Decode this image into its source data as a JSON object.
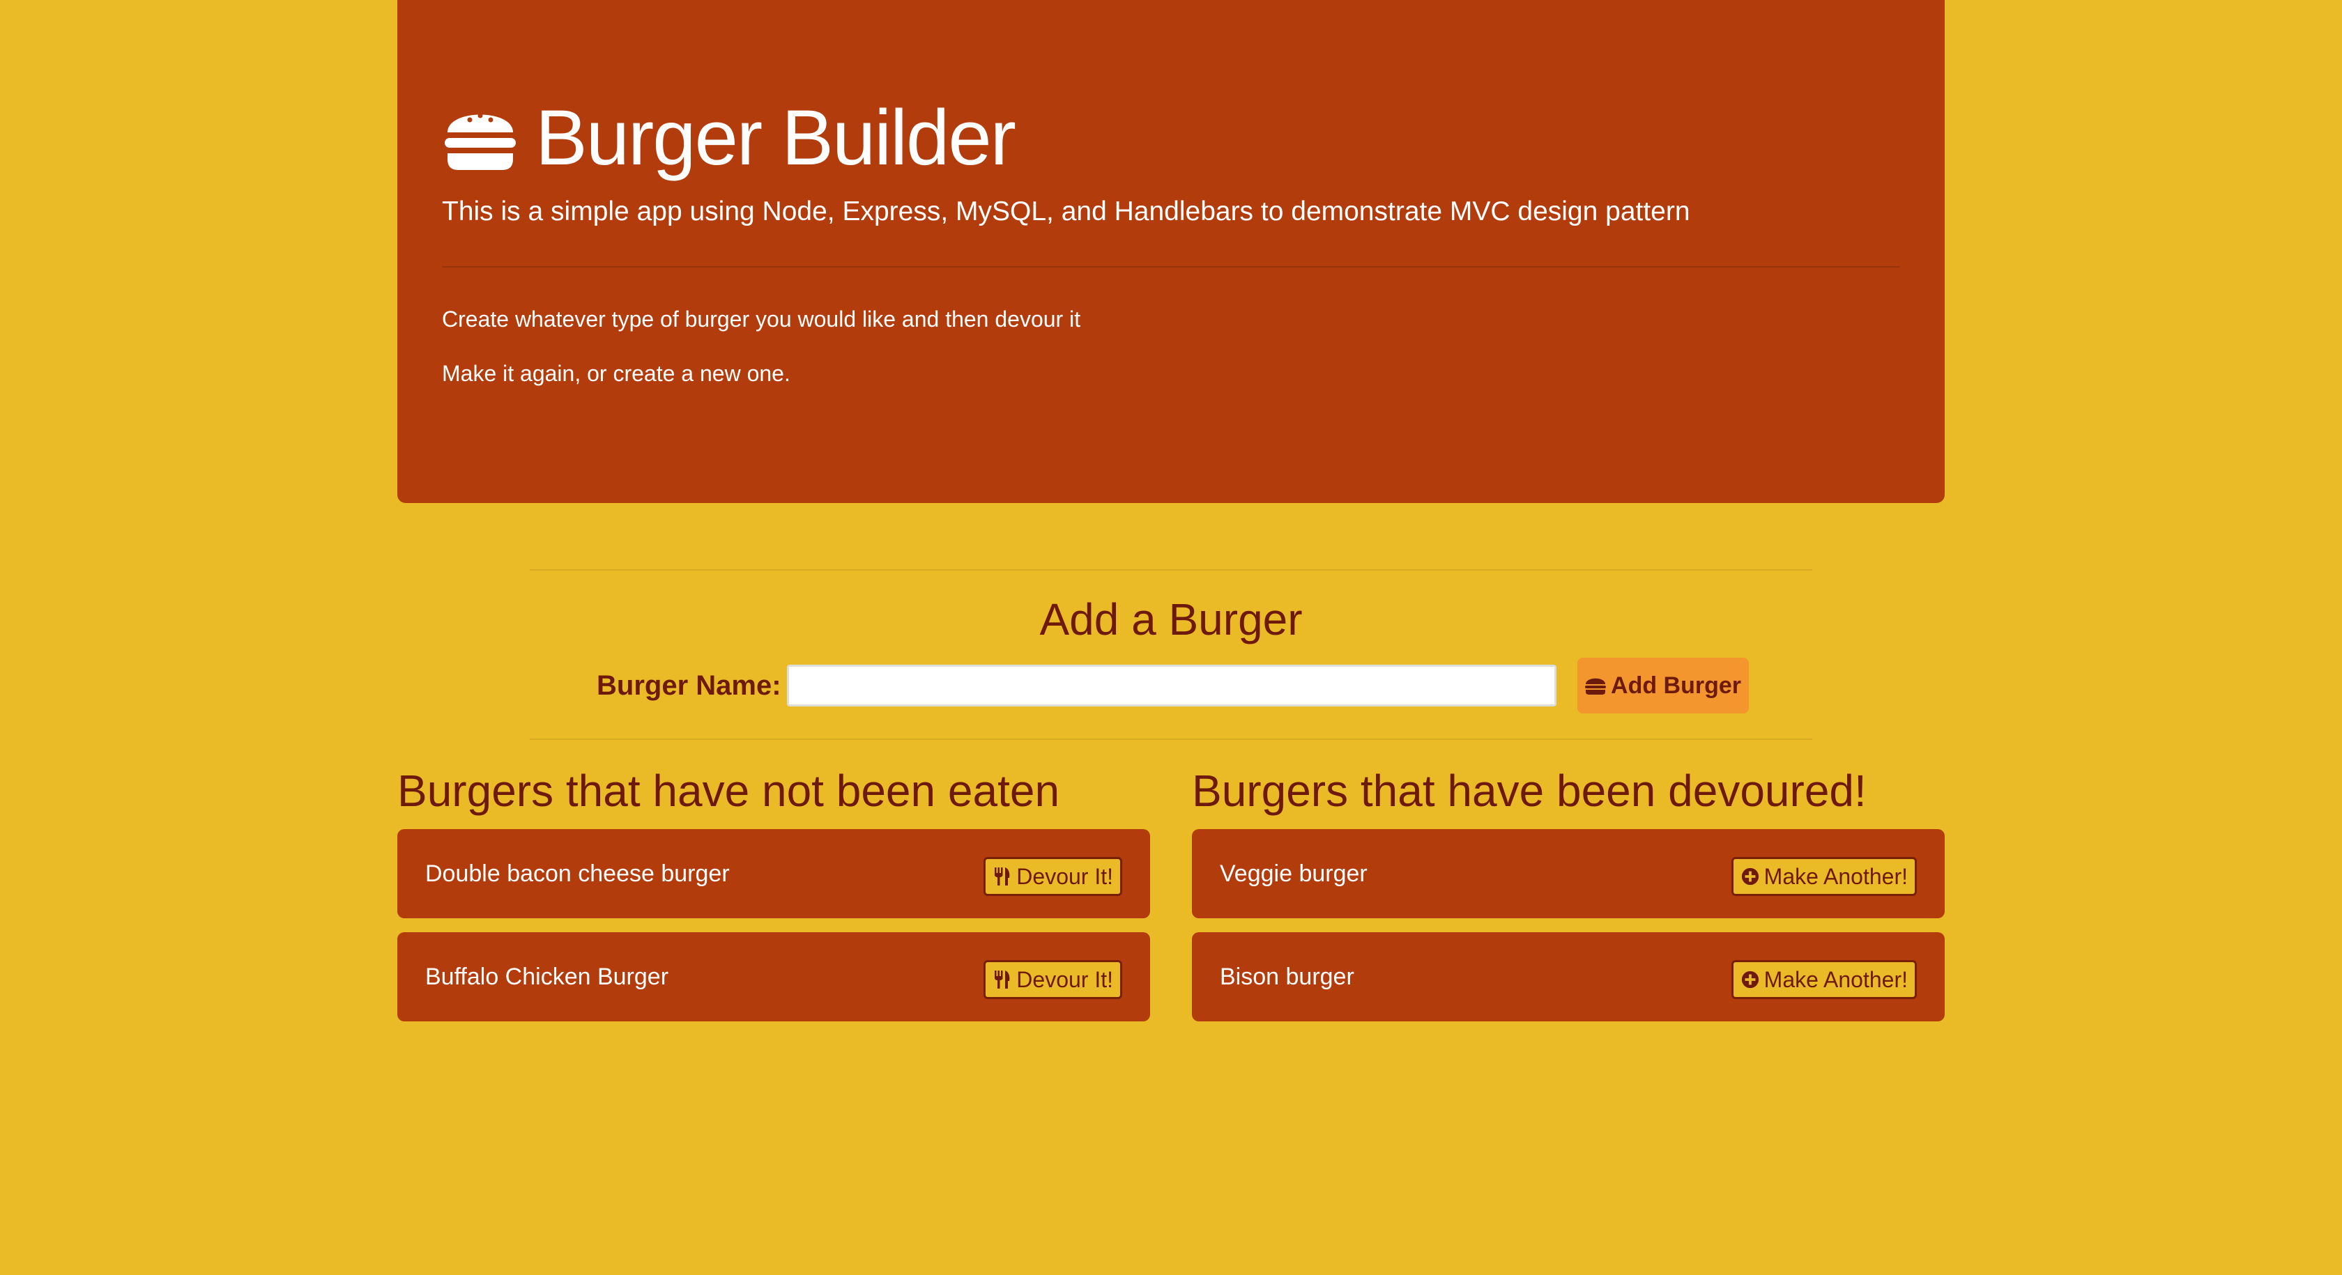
{
  "jumbotron": {
    "icon": "burger-icon",
    "title": "Burger Builder",
    "lead": "This is a simple app using Node, Express, MySQL, and Handlebars to demonstrate MVC design pattern",
    "line1": "Create whatever type of burger you would like and then devour it",
    "line2": "Make it again, or create a new one."
  },
  "add_form": {
    "title": "Add a Burger",
    "label": "Burger Name:",
    "input_value": "",
    "input_placeholder": "",
    "button_label": "Add Burger",
    "button_icon": "burger-icon"
  },
  "not_eaten": {
    "title": "Burgers that have not been eaten",
    "button_icon": "utensils-icon",
    "items": [
      {
        "name": "Double bacon cheese burger",
        "button_label": "Devour It!"
      },
      {
        "name": "Buffalo Chicken Burger",
        "button_label": "Devour It!"
      }
    ]
  },
  "devoured": {
    "title": "Burgers that have been devoured!",
    "button_icon": "plus-circle-icon",
    "items": [
      {
        "name": "Veggie burger",
        "button_label": "Make Another!"
      },
      {
        "name": "Bison burger",
        "button_label": "Make Another!"
      }
    ]
  },
  "colors": {
    "background": "#eabb26",
    "panel": "#b33c0c",
    "heading_text": "#6e1a0a",
    "add_button": "#f3962e"
  }
}
